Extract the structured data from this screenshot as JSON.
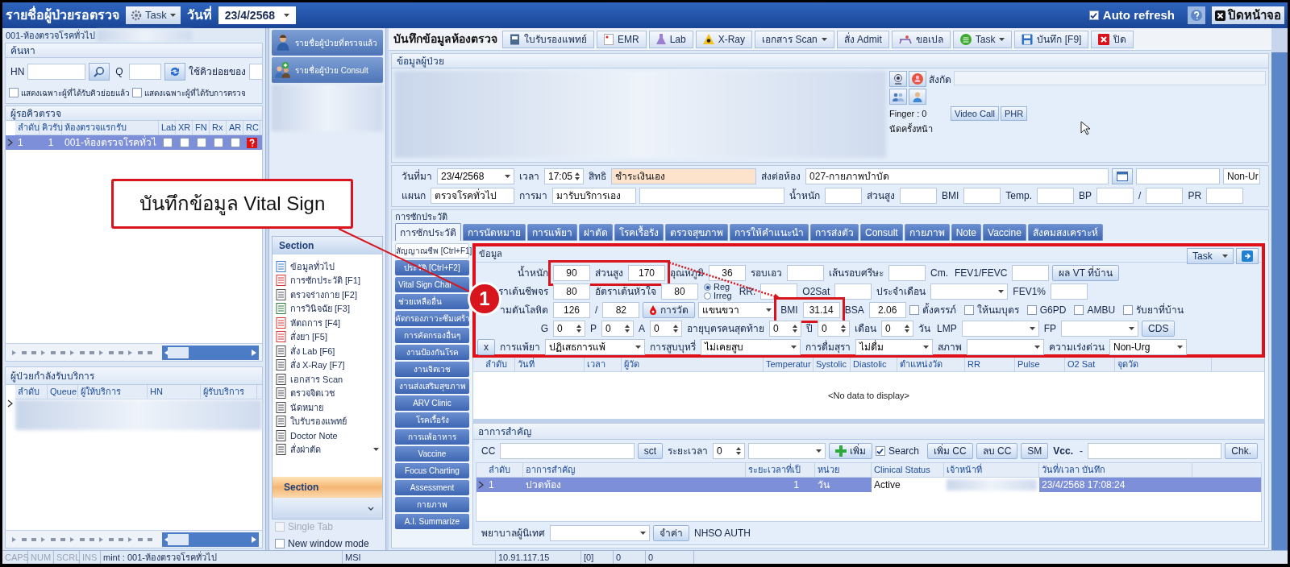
{
  "title_bar": {
    "title": "รายชื่อผู้ป่วยรอตรวจ",
    "task_button": "Task",
    "date_label": "วันที่",
    "date": "23/4/2568",
    "auto_refresh": {
      "label": "Auto refresh",
      "checked": true
    },
    "close_button": "ปิดหน้าจอ"
  },
  "left_panel": {
    "header": "001-ห้องตรวจโรคทั่วไป",
    "search": {
      "title": "ค้นหา",
      "hn_label": "HN",
      "q_label": "Q",
      "queue_label": "ใช้คิวย่อยของ",
      "checkboxes": [
        {
          "label": "แสดงเฉพาะผู้ที่ได้รับคิวย่อยแล้ว",
          "checked": false
        },
        {
          "label": "แสดงเฉพาะผู้ที่ได้รับการตรวจ",
          "checked": false
        }
      ]
    },
    "waiting": {
      "title": "ผู้รอคิวตรวจ",
      "columns": [
        "ลำดับ",
        "คิวรับ",
        "ห้องตรวจแรกรับ",
        "Lab",
        "XR",
        "FN",
        "Rx",
        "AR",
        "RC"
      ],
      "rows": [
        {
          "cells": [
            "1",
            "1",
            "001-ห้องตรวจโรคทั่วไ"
          ],
          "flags": [
            {
              "checked": false
            },
            {
              "checked": false
            },
            {
              "checked": false
            },
            {
              "checked": false
            },
            {
              "checked": false
            }
          ],
          "selected": true
        }
      ]
    },
    "in_service": {
      "title": "ผู้ป่วยกำลังรับบริการ",
      "columns": [
        "ลำดับ",
        "Queue",
        "ผู้ให้บริการ",
        "HN",
        "ผู้รับบริการ"
      ]
    }
  },
  "middle_panel": {
    "buttons": [
      "รายชื่อผู้ป่วยที่ตรวจแล้ว",
      "รายชื่อผู้ป่วย Consult"
    ],
    "section_title": "Section",
    "section_items": [
      "ข้อมูลทั่วไป",
      "การซักประวัติ [F1]",
      "ตรวจร่างกาย  [F2]",
      "การวินิจฉัย [F3]",
      "หัตถการ [F4]",
      "สั่งยา [F5]",
      "สั่ง Lab  [F6]",
      "สั่ง X-Ray  [F7]",
      "เอกสาร Scan",
      "ตรวจจิตเวช",
      "นัดหมาย",
      "ใบรับรองแพทย์",
      "Doctor Note",
      "สั่งผ่าตัด"
    ],
    "section_footer": "Section",
    "options": [
      {
        "label": "Single Tab",
        "checked": false,
        "disabled": true
      },
      {
        "label": "New window mode",
        "checked": false,
        "disabled": false
      }
    ]
  },
  "main": {
    "title": "บันทึกข้อมูลห้องตรวจ",
    "toolbar": [
      {
        "label": "ใบรับรองแพทย์"
      },
      {
        "label": "EMR"
      },
      {
        "label": "Lab"
      },
      {
        "label": "X-Ray"
      },
      {
        "label": "เอกสาร Scan",
        "dropdown": true
      },
      {
        "label": "สั่ง Admit"
      },
      {
        "label": "ขอเปล"
      },
      {
        "label": "Task",
        "dropdown": true
      },
      {
        "label": "บันทึก [F9]"
      },
      {
        "label": "ปิด"
      }
    ],
    "patient": {
      "title": "ข้อมูลผู้ป่วย",
      "affiliation_label": "สังกัด",
      "finger": "Finger : 0",
      "buttons": [
        "Video Call",
        "PHR"
      ],
      "next_appointment": "นัดครั้งหน้า"
    },
    "visit": {
      "rows": [
        [
          {
            "kind": "label",
            "text": "วันที่มา"
          },
          {
            "kind": "select",
            "value": "23/4/2568"
          },
          {
            "kind": "label",
            "text": "เวลา"
          },
          {
            "kind": "spin",
            "value": "17:05"
          },
          {
            "kind": "label",
            "text": "สิทธิ"
          },
          {
            "kind": "wide_field",
            "value": "ชำระเงินเอง",
            "highlighted": true
          },
          {
            "kind": "label",
            "text": "ส่งต่อห้อง"
          },
          {
            "kind": "long_field",
            "value": "027-กายภาพบำบัด",
            "highlighted": false
          },
          {
            "kind": "icon_button"
          },
          {
            "kind": "mid_field"
          },
          {
            "kind": "field",
            "value": "Non-Ur"
          }
        ],
        [
          {
            "kind": "label",
            "text": "แผนก"
          },
          {
            "kind": "mid_field",
            "value": "ตรวจโรคทั่วไป"
          },
          {
            "kind": "label",
            "text": "การมา"
          },
          {
            "kind": "mid_field",
            "value": "มารับบริการเอง"
          },
          {
            "kind": "wide_field",
            "highlighted": false
          },
          {
            "kind": "label",
            "text": "น้ำหนัก"
          },
          {
            "kind": "field"
          },
          {
            "kind": "label",
            "text": "ส่วนสูง"
          },
          {
            "kind": "field"
          },
          {
            "kind": "label",
            "text": "BMI"
          },
          {
            "kind": "field"
          },
          {
            "kind": "label",
            "text": "Temp."
          },
          {
            "kind": "field"
          },
          {
            "kind": "label",
            "text": "BP"
          },
          {
            "kind": "field"
          },
          {
            "kind": "label",
            "text": "/"
          },
          {
            "kind": "field"
          },
          {
            "kind": "label",
            "text": "PR"
          },
          {
            "kind": "field"
          }
        ]
      ]
    },
    "history": {
      "title": "การซักประวัติ",
      "tabs": [
        {
          "label": "การซักประวัติ",
          "selected": true
        },
        {
          "label": "การนัดหมาย",
          "selected": false
        },
        {
          "label": "การแพ้ยา",
          "selected": false
        },
        {
          "label": "ผ่าตัด",
          "selected": false
        },
        {
          "label": "โรคเรื้อรัง",
          "selected": false
        },
        {
          "label": "ตรวจสุขภาพ",
          "selected": false
        },
        {
          "label": "การให้คำแนะนำ",
          "selected": false
        },
        {
          "label": "การส่งตัว",
          "selected": false
        },
        {
          "label": "Consult",
          "selected": false
        },
        {
          "label": "กายภาพ",
          "selected": false
        },
        {
          "label": "Note",
          "selected": false
        },
        {
          "label": "Vaccine",
          "selected": false
        },
        {
          "label": "สังคมสงเคราะห์",
          "selected": false
        }
      ],
      "side_tabs": [
        {
          "label": "สัญญาณชีพ [Ctrl+F1]",
          "selected": true
        },
        {
          "label": "ประวัติ [Ctrl+F2]",
          "selected": false
        },
        {
          "label": "Vital Sign Char",
          "selected": false
        },
        {
          "label": "ช่วยเหลืออื่น",
          "selected": false
        },
        {
          "label": "คัดกรองภาวะซึมเศร้า",
          "selected": false
        },
        {
          "label": "การคัดกรองอื่นๆ",
          "selected": false
        },
        {
          "label": "งานป้องกันโรค",
          "selected": false
        },
        {
          "label": "งานจิตเวช",
          "selected": false
        },
        {
          "label": "งานส่งเสริมสุขภาพ",
          "selected": false
        },
        {
          "label": "ARV Clinic",
          "selected": false
        },
        {
          "label": "โรคเรื้อรัง",
          "selected": false
        },
        {
          "label": "การแพ้อาหาร",
          "selected": false
        },
        {
          "label": "Vaccine",
          "selected": false
        },
        {
          "label": "Focus Charting",
          "selected": false
        },
        {
          "label": "Assessment",
          "selected": false
        },
        {
          "label": "กายภาพ",
          "selected": false
        },
        {
          "label": "A.I. Summarize",
          "selected": false
        }
      ],
      "vitals": {
        "title": "ข้อมูล",
        "task": "Task",
        "lines": [
          [
            {
              "kind": "label",
              "text": "น้ำหนัก"
            },
            {
              "kind": "field",
              "value": "90"
            },
            {
              "kind": "label",
              "text": "ส่วนสูง"
            },
            {
              "kind": "field",
              "value": "170"
            },
            {
              "kind": "label",
              "text": "อุณหภูมิ"
            },
            {
              "kind": "field",
              "value": "36"
            },
            {
              "kind": "label",
              "text": "รอบเอว"
            },
            {
              "kind": "field"
            },
            {
              "kind": "label",
              "text": "เส้นรอบศรีษะ"
            },
            {
              "kind": "field"
            },
            {
              "kind": "label",
              "text": "Cm."
            },
            {
              "kind": "label",
              "text": "FEV1/FEVC"
            },
            {
              "kind": "field"
            },
            {
              "kind": "button",
              "text": "ผล VT ที่บ้าน"
            }
          ],
          [
            {
              "kind": "label",
              "text": "ราเต้นชีพจร"
            },
            {
              "kind": "field",
              "value": "80"
            },
            {
              "kind": "label",
              "text": "อัตราเต้นหัวใจ"
            },
            {
              "kind": "field",
              "value": "80"
            },
            {
              "kind": "radio_group",
              "options": [
                {
                  "label": "Reg",
                  "selected": true
                },
                {
                  "label": "Irreg",
                  "selected": false
                }
              ]
            },
            {
              "kind": "label",
              "text": "RR."
            },
            {
              "kind": "field"
            },
            {
              "kind": "label",
              "text": "O2Sat"
            },
            {
              "kind": "field"
            },
            {
              "kind": "label",
              "text": "ประจำเดือน"
            },
            {
              "kind": "select"
            },
            {
              "kind": "label",
              "text": "FEV1%"
            },
            {
              "kind": "field"
            }
          ],
          [
            {
              "kind": "label",
              "text": "ามดันโลหิต"
            },
            {
              "kind": "field",
              "value": "126"
            },
            {
              "kind": "label",
              "text": "/"
            },
            {
              "kind": "field",
              "value": "82"
            },
            {
              "kind": "button",
              "text": "การวัด"
            },
            {
              "kind": "select",
              "value": "แขนขวา"
            },
            {
              "kind": "label",
              "text": "BMI"
            },
            {
              "kind": "field",
              "value": "31.14"
            },
            {
              "kind": "label",
              "text": "BSA"
            },
            {
              "kind": "field",
              "value": "2.06"
            },
            {
              "kind": "checkbox",
              "text": "ตั้งครรภ์",
              "checked": false
            },
            {
              "kind": "checkbox",
              "text": "ให้นมบุตร",
              "checked": false
            },
            {
              "kind": "checkbox",
              "text": "G6PD",
              "checked": false
            },
            {
              "kind": "checkbox",
              "text": "AMBU",
              "checked": false
            },
            {
              "kind": "checkbox",
              "text": "รับยาที่บ้าน",
              "checked": false
            }
          ],
          [
            {
              "kind": "label",
              "text": "G"
            },
            {
              "kind": "spin",
              "value": "0"
            },
            {
              "kind": "label",
              "text": "P"
            },
            {
              "kind": "spin",
              "value": "0"
            },
            {
              "kind": "label",
              "text": "A"
            },
            {
              "kind": "spin",
              "value": "0"
            },
            {
              "kind": "label",
              "text": "อายุบุตรคนสุดท้าย"
            },
            {
              "kind": "spin",
              "value": "0"
            },
            {
              "kind": "label",
              "text": "ปี"
            },
            {
              "kind": "spin",
              "value": "0"
            },
            {
              "kind": "label",
              "text": "เดือน"
            },
            {
              "kind": "spin",
              "value": "0"
            },
            {
              "kind": "label",
              "text": "วัน"
            },
            {
              "kind": "label",
              "text": "LMP"
            },
            {
              "kind": "select"
            },
            {
              "kind": "label",
              "text": "FP"
            },
            {
              "kind": "select"
            },
            {
              "kind": "button",
              "text": "CDS"
            }
          ],
          [
            {
              "kind": "button",
              "text": "x"
            },
            {
              "kind": "label",
              "text": "การแพ้ยา"
            },
            {
              "kind": "wide_select",
              "value": "ปฏิเสธการแพ้"
            },
            {
              "kind": "label",
              "text": "การสูบบุหรี่"
            },
            {
              "kind": "wide_select",
              "value": "ไม่เคยสูบ"
            },
            {
              "kind": "label",
              "text": "การดื่มสุรา"
            },
            {
              "kind": "select",
              "value": "ไม่ดื่ม"
            },
            {
              "kind": "label",
              "text": "สภาพ"
            },
            {
              "kind": "select"
            },
            {
              "kind": "label",
              "text": "ความเร่งด่วน"
            },
            {
              "kind": "select",
              "value": "Non-Urg"
            }
          ]
        ]
      },
      "vitals_table": {
        "columns": [
          "ลำดับ",
          "วันที่",
          "เวลา",
          "ผู้วัด",
          "Temperatur",
          "Systolic",
          "Diastolic",
          "ตำแหน่งวัด",
          "RR",
          "Pulse",
          "O2 Sat",
          "จุดวัด"
        ],
        "empty": "<No data to display>"
      },
      "complaints": {
        "title": "อาการสำคัญ",
        "toolbar": [
          {
            "kind": "label",
            "text": "CC"
          },
          {
            "kind": "long_field"
          },
          {
            "kind": "button",
            "text": "sct"
          },
          {
            "kind": "label",
            "text": "ระยะเวลา"
          },
          {
            "kind": "spin",
            "value": "0"
          },
          {
            "kind": "select"
          },
          {
            "kind": "button",
            "text": "เพิ่ม"
          },
          {
            "kind": "checkbox",
            "text": "Search",
            "checked": true
          },
          {
            "kind": "button",
            "text": "เพิ่ม CC"
          },
          {
            "kind": "button",
            "text": "ลบ CC"
          },
          {
            "kind": "button",
            "text": "SM"
          },
          {
            "kind": "bold_label",
            "text": "Vcc."
          },
          {
            "kind": "label",
            "text": "-"
          },
          {
            "kind": "long_field"
          },
          {
            "kind": "button",
            "text": "Chk."
          }
        ],
        "columns": [
          "ลำดับ",
          "อาการสำคัญ",
          "ระยะเวลาที่เป็",
          "หน่วย",
          "Clinical Status",
          "เจ้าหน้าที่",
          "วันที่/เวลา บันทึก"
        ],
        "rows": [
          {
            "cells": [
              "1",
              "ปวดท้อง",
              "1",
              "วัน",
              "Active"
            ],
            "recorded": "23/4/2568 17:08:24",
            "selected": true
          }
        ],
        "footer": [
          {
            "kind": "label",
            "text": "พยาบาลผู้นิเทศ"
          },
          {
            "kind": "wide_select"
          },
          {
            "kind": "button",
            "text": "จำค่า"
          },
          {
            "kind": "label",
            "text": "NHSO AUTH"
          }
        ]
      }
    }
  },
  "status_bar": [
    "CAPS",
    "NUM",
    "SCRL",
    "INS",
    "mint : 001-ห้องตรวจโรคทั่วไป",
    "MSI",
    "10.91.117.15",
    "[0]",
    "0",
    "0"
  ],
  "annotation": {
    "text": "บันทึกข้อมูล Vital Sign",
    "number": "1"
  }
}
